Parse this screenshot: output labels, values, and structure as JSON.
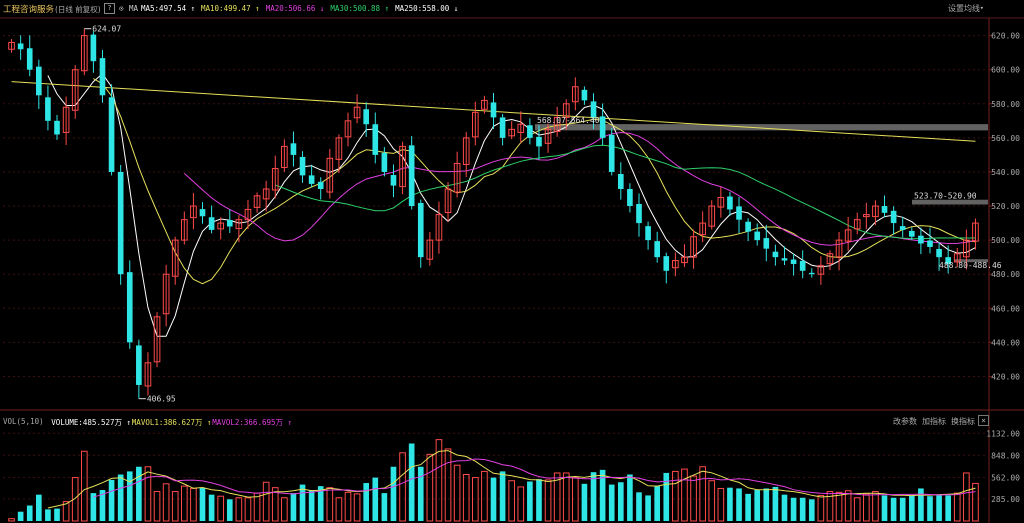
{
  "header": {
    "title": "工程咨询服务",
    "period": "(日线 前复权)",
    "help": "?",
    "ma_prefix": "MA",
    "settings_label": "设置均线",
    "settings_chevron": "▾"
  },
  "legend": [
    {
      "text": "MA5:497.54",
      "arrow": "↑",
      "color": "#ffffff"
    },
    {
      "text": "MA10:499.47",
      "arrow": "↑",
      "color": "#e6e05a"
    },
    {
      "text": "MA20:506.66",
      "arrow": "↓",
      "color": "#e040e0"
    },
    {
      "text": "MA30:500.88",
      "arrow": "↑",
      "color": "#2fd26a"
    },
    {
      "text": "MA250:558.00",
      "arrow": "↓",
      "color": "#ffffff"
    }
  ],
  "volume_legend": [
    {
      "text": "VOL(5,10)",
      "color": "#aaaaaa"
    },
    {
      "text": "VOLUME:485.527万",
      "arrow": "↑",
      "color": "#ffffff"
    },
    {
      "text": "MAVOL1:386.627万",
      "arrow": "↑",
      "color": "#e6e05a"
    },
    {
      "text": "MAVOL2:366.695万",
      "arrow": "↑",
      "color": "#e040e0"
    }
  ],
  "sub_buttons": [
    "改参数",
    "加指标",
    "换指标"
  ],
  "close_label": "×",
  "annotations": {
    "high": "624.07",
    "low": "406.95",
    "gap1": "568.07-564.40",
    "gap2": "523.70-520.90",
    "gap3": "488.80-488.46"
  },
  "colors": {
    "up": "#ff4a4a",
    "down": "#2fe6e6",
    "ma5": "#ffffff",
    "ma10": "#e6e05a",
    "ma20": "#e040e0",
    "ma30": "#2fd26a",
    "ma250": "#e6e05a",
    "axis_text": "#aaaaaa",
    "grid": "#3a0f0f"
  },
  "chart_data": [
    {
      "type": "candlestick",
      "title": "",
      "ylim": [
        405,
        628
      ],
      "yticks": [
        420,
        440,
        460,
        480,
        500,
        520,
        540,
        560,
        580,
        600,
        620
      ],
      "ma250_start": 593,
      "ma250_end": 558,
      "gaps": [
        {
          "from": 564.4,
          "to": 568.07
        },
        {
          "from": 520.9,
          "to": 523.7
        },
        {
          "from": 488.46,
          "to": 488.8
        }
      ],
      "close": [
        616,
        612,
        600,
        585,
        570,
        562,
        578,
        600,
        620,
        605,
        585,
        540,
        480,
        440,
        415,
        428,
        455,
        480,
        500,
        512,
        520,
        514,
        506,
        510,
        508,
        512,
        518,
        526,
        530,
        542,
        555,
        550,
        538,
        533,
        530,
        548,
        560,
        570,
        578,
        568,
        550,
        540,
        532,
        555,
        520,
        490,
        500,
        515,
        530,
        545,
        560,
        575,
        582,
        572,
        560,
        565,
        568,
        560,
        555,
        565,
        572,
        580,
        590,
        582,
        572,
        560,
        540,
        530,
        520,
        510,
        500,
        490,
        482,
        488,
        490,
        502,
        510,
        520,
        525,
        518,
        512,
        505,
        500,
        495,
        490,
        488,
        486,
        482,
        480,
        485,
        492,
        500,
        506,
        512,
        515,
        520,
        516,
        510,
        506,
        502,
        498,
        496,
        490,
        486,
        492,
        500,
        510
      ],
      "volume_wan": [
        30,
        120,
        200,
        340,
        150,
        160,
        250,
        560,
        900,
        360,
        400,
        530,
        600,
        640,
        700,
        700,
        380,
        480,
        380,
        450,
        420,
        430,
        340,
        320,
        280,
        300,
        300,
        360,
        500,
        430,
        300,
        360,
        470,
        400,
        450,
        430,
        300,
        370,
        350,
        490,
        560,
        360,
        700,
        880,
        1000,
        700,
        860,
        1050,
        930,
        720,
        600,
        560,
        640,
        560,
        640,
        520,
        440,
        510,
        540,
        530,
        620,
        620,
        560,
        480,
        630,
        660,
        470,
        500,
        600,
        370,
        330,
        450,
        620,
        640,
        670,
        580,
        700,
        520,
        420,
        430,
        420,
        350,
        400,
        420,
        440,
        340,
        300,
        300,
        280,
        330,
        380,
        370,
        390,
        300,
        350,
        380,
        330,
        300,
        300,
        330,
        420,
        320,
        330,
        330,
        360,
        620,
        485
      ]
    },
    {
      "type": "bar",
      "title": "",
      "ylim": [
        0,
        1200
      ],
      "yticks": [
        285,
        562,
        848,
        1132
      ],
      "ytick_labels": [
        "285.00",
        "562.00",
        "848.00",
        "1132.00"
      ]
    }
  ]
}
